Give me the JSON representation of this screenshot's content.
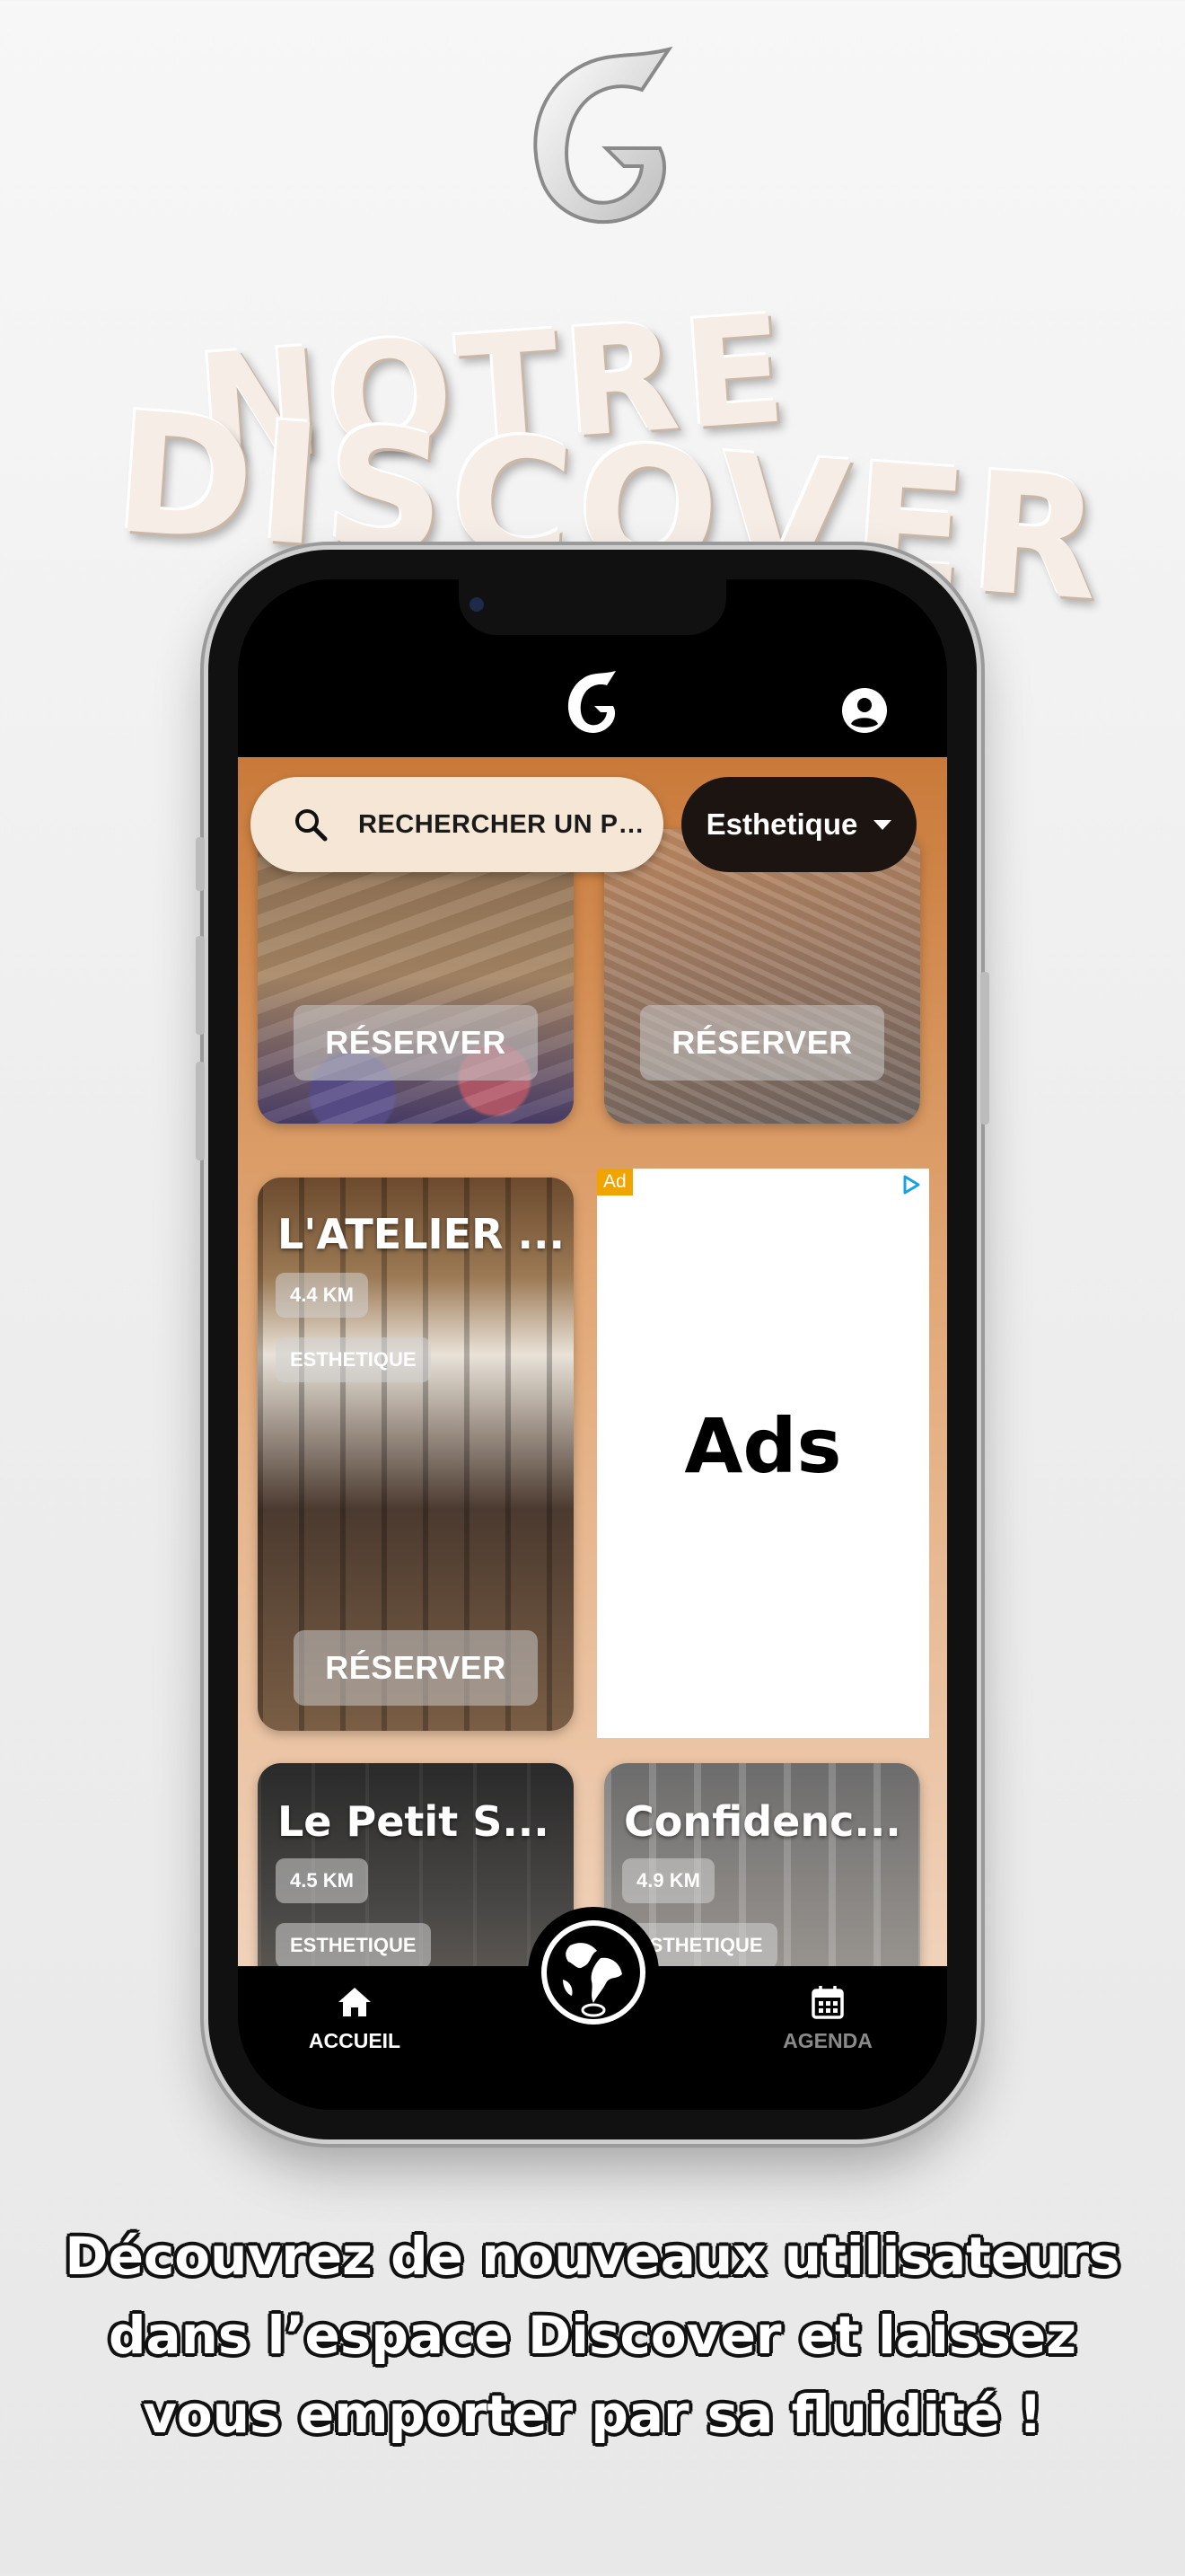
{
  "headline": {
    "line1": "NOTRE",
    "line2": "DISCOVER"
  },
  "app": {
    "search": {
      "placeholder": "RECHERCHER UN PRESTATAI..."
    },
    "category": {
      "selected": "Esthetique"
    },
    "cards": [
      {
        "title": "",
        "button": "RÉSERVER"
      },
      {
        "title": "",
        "button": "RÉSERVER"
      },
      {
        "title": "L'ATELIER ...",
        "distance": "4.4 KM",
        "tag": "ESTHETIQUE",
        "button": "RÉSERVER"
      },
      {
        "title": "Le Petit S...",
        "distance": "4.5 KM",
        "tag": "ESTHETIQUE"
      },
      {
        "title": "Confidenc...",
        "distance": "4.9 KM",
        "tag": "ESTHETIQUE"
      }
    ],
    "ad": {
      "badge": "Ad",
      "text": "Ads"
    },
    "nav": {
      "home": {
        "label": "ACCUEIL",
        "icon": "home-icon"
      },
      "center": {
        "icon": "globe-icon"
      },
      "agenda": {
        "label": "AGENDA",
        "icon": "calendar-icon"
      }
    }
  },
  "caption": {
    "line1": "Découvrez de nouveaux utilisateurs",
    "line2": "dans l’espace Discover et laissez",
    "line3": "vous emporter par sa fluidité !"
  },
  "colors": {
    "accent": "#c97a3a",
    "dark": "#000000",
    "pill_dark": "#1c1410"
  }
}
